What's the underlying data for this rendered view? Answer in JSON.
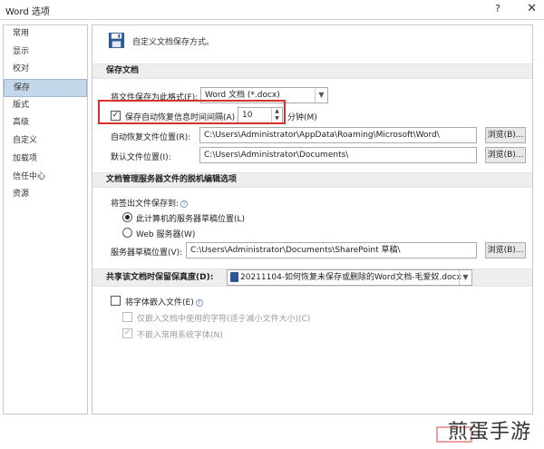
{
  "window": {
    "title": "Word 选项",
    "help_glyph": "?",
    "close_glyph": "✕"
  },
  "nav": {
    "items": [
      "常用",
      "显示",
      "校对",
      "保存",
      "版式",
      "高级",
      "自定义",
      "加载项",
      "信任中心",
      "资源"
    ],
    "selected": "保存"
  },
  "header": {
    "text": "自定义文档保存方式。",
    "icon": "save-icon"
  },
  "save_section": {
    "title": "保存文档",
    "format_label": "将文件保存为此格式(F):",
    "format_value": "Word 文档 (*.docx)",
    "autorecover_label": "保存自动恢复信息时间间隔(A)",
    "autorecover_checked": true,
    "autorecover_value": "10",
    "minutes_label": "分钟(M)",
    "autorecover_location_label": "自动恢复文件位置(R):",
    "autorecover_location_value": "C:\\Users\\Administrator\\AppData\\Roaming\\Microsoft\\Word\\",
    "default_location_label": "默认文件位置(I):",
    "default_location_value": "C:\\Users\\Administrator\\Documents\\",
    "browse_label": "浏览(B)...",
    "browse_label_2": "浏览(B)..."
  },
  "offline_section": {
    "title": "文档管理服务器文件的脱机编辑选项",
    "checkout_label": "将签出文件保存到:",
    "option_server_drafts": "此计算机的服务器草稿位置(L)",
    "option_web_server": "Web 服务器(W)",
    "drafts_location_label": "服务器草稿位置(V):",
    "drafts_location_value": "C:\\Users\\Administrator\\Documents\\SharePoint 草稿\\",
    "browse_label": "浏览(B)..."
  },
  "fidelity_section": {
    "title": "共享该文档时保留保真度(D):",
    "doc_value": "20211104-如何恢复未保存或删除的Word文档-毛爱奴.docx",
    "embed_fonts_label": "将字体嵌入文件(E)",
    "embed_used_chars_label": "仅嵌入文档中使用的字符(适于减小文件大小)(C)",
    "no_system_fonts_label": "不嵌入常用系统字体(N)"
  },
  "watermark": {
    "text": "煎蛋手游"
  },
  "colors": {
    "accent": "#2b579a",
    "highlight": "#d9302c",
    "selected_bg": "#c5d7ea",
    "section_bg": "#eeeeee"
  }
}
